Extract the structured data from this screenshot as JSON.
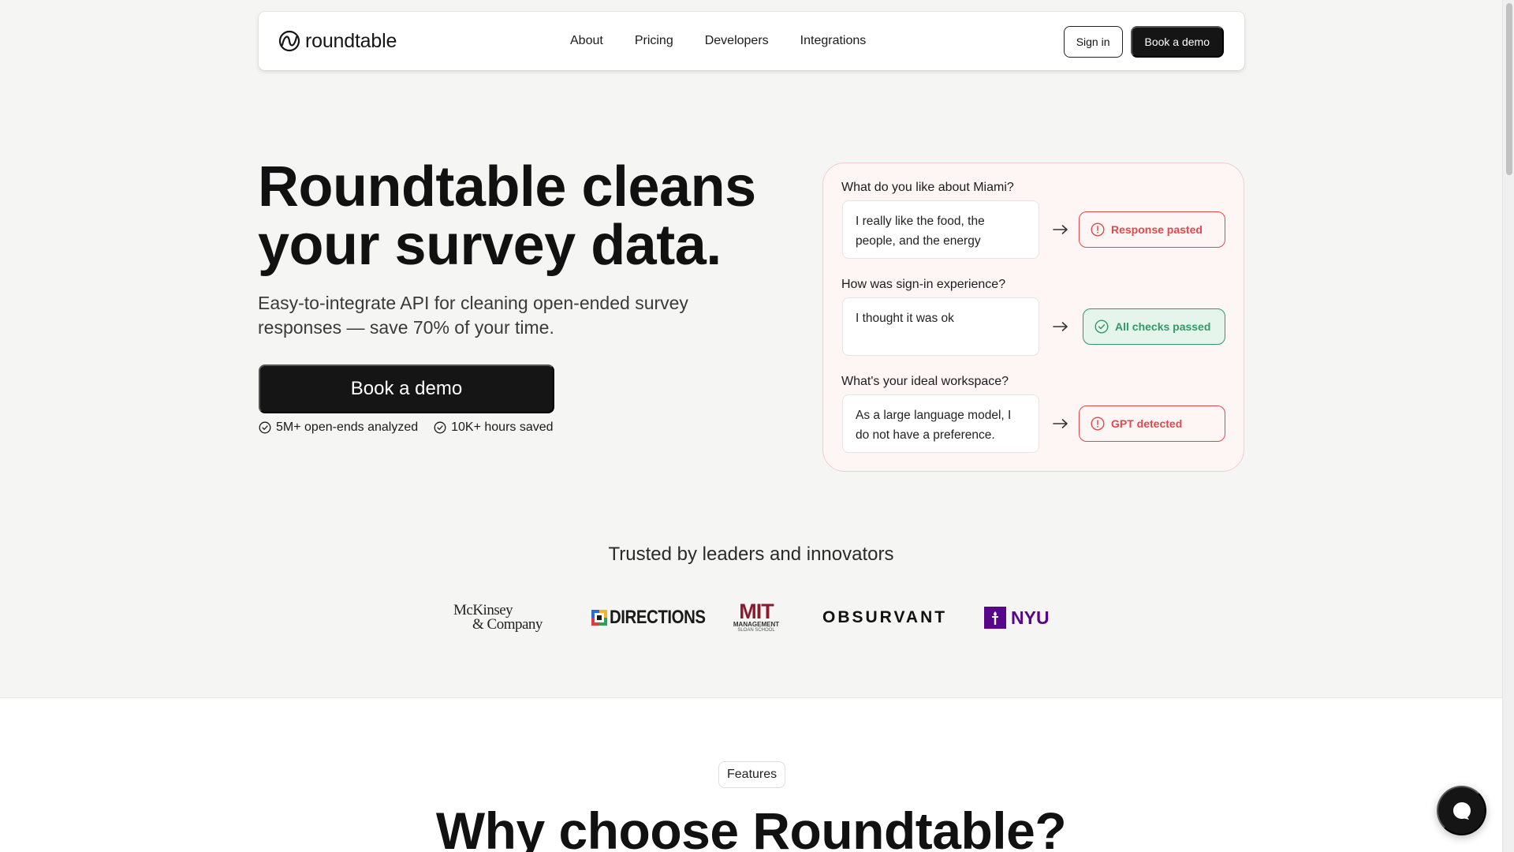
{
  "brand": {
    "name": "roundtable",
    "logo_icon": "roundtable-logo-icon"
  },
  "nav": {
    "links": [
      "About",
      "Pricing",
      "Developers",
      "Integrations"
    ],
    "sign_in": "Sign in",
    "book_demo": "Book a demo"
  },
  "hero": {
    "title_line1": "Roundtable cleans",
    "title_line2": "your survey data.",
    "subtitle_line1": "Easy-to-integrate API for cleaning open-ended survey",
    "subtitle_line2": "responses — save 70% of your time.",
    "cta": "Book a demo",
    "stats": [
      "5M+ open-ends analyzed",
      "10K+ hours saved"
    ]
  },
  "survey_card": {
    "items": [
      {
        "question": "What do you like about Miami?",
        "answer_line1": "I really like the food, the",
        "answer_line2": "people, and the energy",
        "status": "Response pasted",
        "status_type": "error",
        "status_color": "#e0484e"
      },
      {
        "question": "How was sign-in experience?",
        "answer_line1": "I thought it was ok",
        "answer_line2": "",
        "status": "All checks passed",
        "status_type": "success",
        "status_color": "#2e9a67"
      },
      {
        "question": "What's your ideal workspace?",
        "answer_line1": "As a large language model, I",
        "answer_line2": "do not have a preference.",
        "status": "GPT detected",
        "status_type": "error",
        "status_color": "#e0484e"
      }
    ]
  },
  "trusted": {
    "heading": "Trusted by leaders and innovators",
    "logos": {
      "mckinsey_line1": "McKinsey",
      "mckinsey_line2": "& Company",
      "directions": "DIRECTIONS",
      "mit_main": "MIT",
      "mit_line1": "MANAGEMENT",
      "mit_line2": "SLOAN SCHOOL",
      "observant": "OBSURVANT",
      "nyu": "NYU"
    }
  },
  "features": {
    "badge": "Features",
    "heading": "Why choose Roundtable?"
  },
  "colors": {
    "error": "#e0484e",
    "success": "#2e9a67",
    "nyu_purple": "#57068c",
    "dark": "#151515"
  }
}
